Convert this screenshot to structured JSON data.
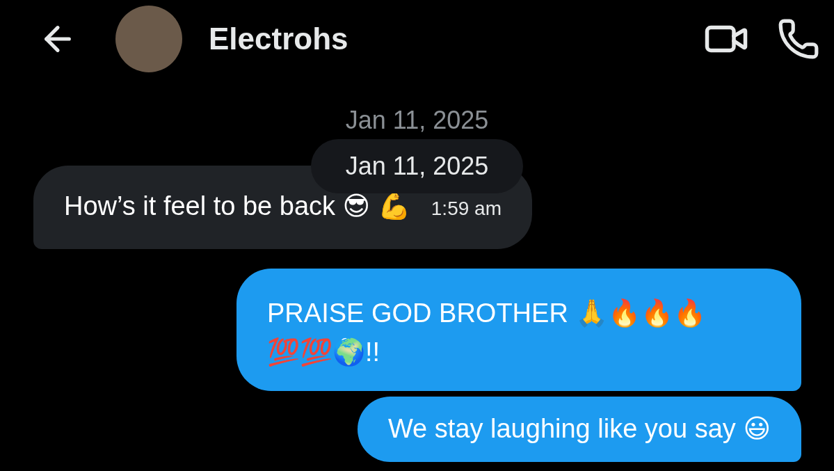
{
  "header": {
    "title": "Electrohs"
  },
  "sticky_date": "Jan 11, 2025",
  "date_pill": "Jan 11, 2025",
  "messages": [
    {
      "kind": "received",
      "text": "How’s it feel to be back 😎 💪",
      "time": "1:59 am"
    },
    {
      "kind": "sent",
      "text": "PRAISE GOD BROTHER 🙏🔥🔥🔥 💯💯🌍!!"
    },
    {
      "kind": "sent",
      "text": "We stay laughing like you say 😃"
    }
  ]
}
